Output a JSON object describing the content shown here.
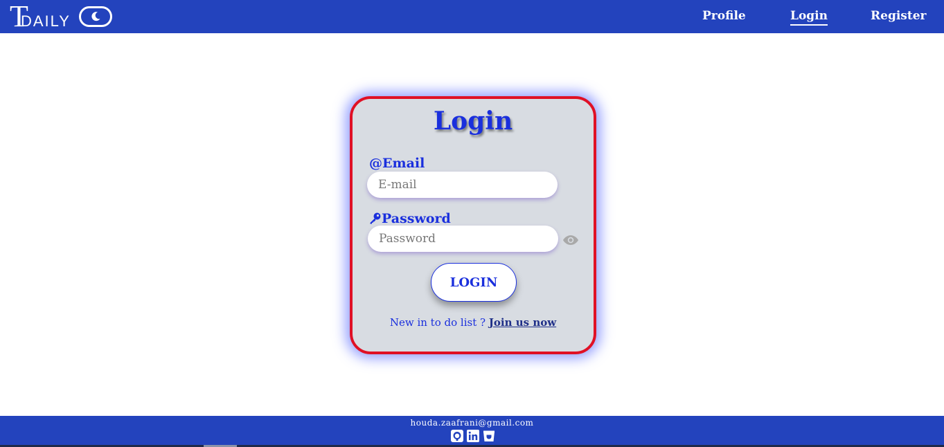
{
  "brand": {
    "logo_letter": "T",
    "logo_word": "DAILY"
  },
  "nav": {
    "profile": "Profile",
    "login": "Login",
    "register": "Register"
  },
  "login_form": {
    "title": "Login",
    "email_label": "@Email",
    "email_placeholder": "E-mail",
    "email_value": "",
    "password_label": "Password",
    "password_placeholder": "Password",
    "password_value": "",
    "submit_label": "LOGIN",
    "join_prompt": "New in to do list ?",
    "join_link": "Join us now"
  },
  "footer": {
    "email": "houda.zaafrani@gmail.com",
    "icons": [
      "github-icon",
      "linkedin-icon",
      "portfolio-icon"
    ]
  },
  "colors": {
    "primary_blue": "#2343bd",
    "accent_blue": "#1a2fdd",
    "card_border": "#e01025",
    "card_bg": "#d8dce2"
  }
}
